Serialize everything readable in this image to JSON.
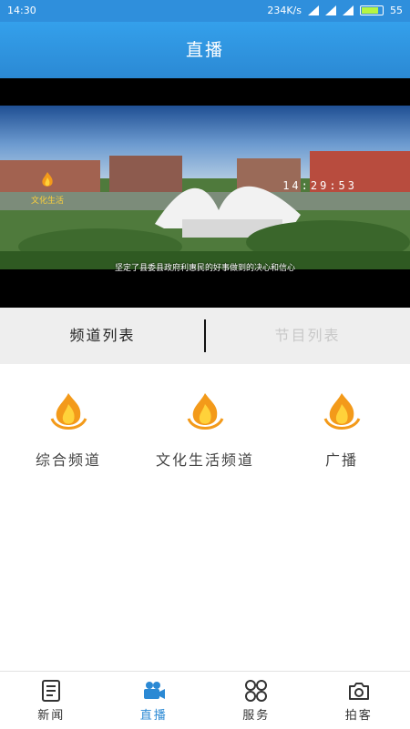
{
  "status_bar": {
    "time": "14:30",
    "net_speed": "234K/s",
    "battery_level": "55"
  },
  "header": {
    "title": "直播"
  },
  "player": {
    "logo_text": "文化生活",
    "clock": "14:29:53",
    "subtitle": "坚定了县委县政府利惠民的好事做到的决心和信心"
  },
  "tabs": [
    {
      "label": "频道列表",
      "active": true
    },
    {
      "label": "节目列表",
      "active": false
    }
  ],
  "channels": [
    {
      "label": "综合频道",
      "icon": "channel-flame-icon"
    },
    {
      "label": "文化生活频道",
      "icon": "channel-flame-icon"
    },
    {
      "label": "广播",
      "icon": "channel-flame-icon"
    }
  ],
  "bottom_nav": [
    {
      "label": "新闻",
      "icon": "news-icon",
      "active": false
    },
    {
      "label": "直播",
      "icon": "video-camera-icon",
      "active": true
    },
    {
      "label": "服务",
      "icon": "grid-icon",
      "active": false
    },
    {
      "label": "拍客",
      "icon": "camera-icon",
      "active": false
    }
  ],
  "colors": {
    "primary": "#2b89d4",
    "tab_bg": "#eeeeee",
    "inactive_tab": "#c8c8c8",
    "flame_orange": "#f39a1a",
    "flame_yellow": "#ffd23a"
  }
}
